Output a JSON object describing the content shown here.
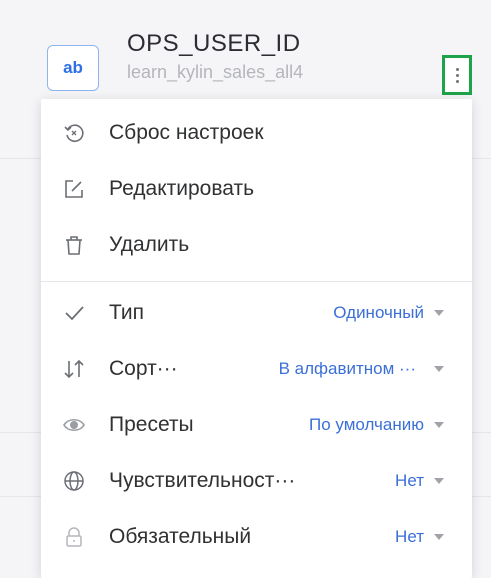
{
  "field": {
    "type_badge": "ab",
    "name": "OPS_USER_ID",
    "source": "learn_kylin_sales_all4"
  },
  "menu": {
    "actions": [
      {
        "label": "Сброс настроек",
        "icon": "reset-icon"
      },
      {
        "label": "Редактировать",
        "icon": "edit-icon"
      },
      {
        "label": "Удалить",
        "icon": "trash-icon"
      }
    ],
    "settings": [
      {
        "label": "Тип",
        "value": "Одиночный",
        "icon": "check-icon"
      },
      {
        "label": "Сорт···",
        "value": "В алфавитном ···",
        "icon": "sort-icon"
      },
      {
        "label": "Пресеты",
        "value": "По умолчанию",
        "icon": "eye-icon"
      },
      {
        "label": "Чувствительност···",
        "value": "Нет",
        "icon": "globe-icon"
      },
      {
        "label": "Обязательный",
        "value": "Нет",
        "icon": "lock-icon"
      }
    ]
  },
  "colors": {
    "accent": "#3b6fd8",
    "highlight": "#1fa34a",
    "badge": "#2f6fe4"
  }
}
